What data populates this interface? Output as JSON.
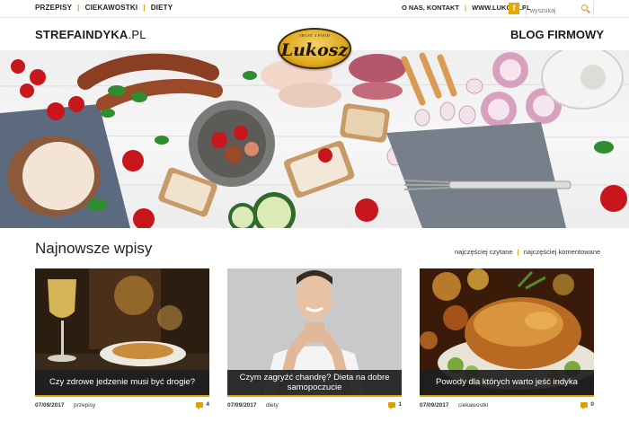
{
  "topnav": {
    "items": [
      "PRZEPISY",
      "CIEKAWOSTKI",
      "DIETY"
    ]
  },
  "toplinks": {
    "about": "O NAS, KONTAKT",
    "site": "WWW.LUKOSZ.PL"
  },
  "facebook": {
    "icon": "facebook-icon",
    "glyph": "f"
  },
  "search": {
    "placeholder": "wyszukaj"
  },
  "header": {
    "brand_bold": "STREFAINDYKA",
    "brand_light": ".PL",
    "blog": "BLOG FIRMOWY",
    "logo_word": "Lukosz",
    "logo_tag": "TRUST 4 FOOD"
  },
  "section": {
    "title": "Najnowsze wpisy",
    "sort_read": "najczęściej czytane",
    "sort_commented": "najczęściej komentowane"
  },
  "posts": [
    {
      "title": "Czy zdrowe jedzenie musi być drogie?",
      "date": "07/09/2017",
      "category": "przepisy",
      "comments": "4"
    },
    {
      "title": "Czym zagryźć chandrę? Dieta na dobre samopoczucie",
      "date": "07/09/2017",
      "category": "diety",
      "comments": "1"
    },
    {
      "title": "Powody dla których warto jeść indyka",
      "date": "07/09/2017",
      "category": "ciekawostki",
      "comments": "0"
    }
  ],
  "colors": {
    "accent": "#e0a100",
    "dark": "#1c1c1c",
    "caption_bg": "#1e1e1e"
  }
}
